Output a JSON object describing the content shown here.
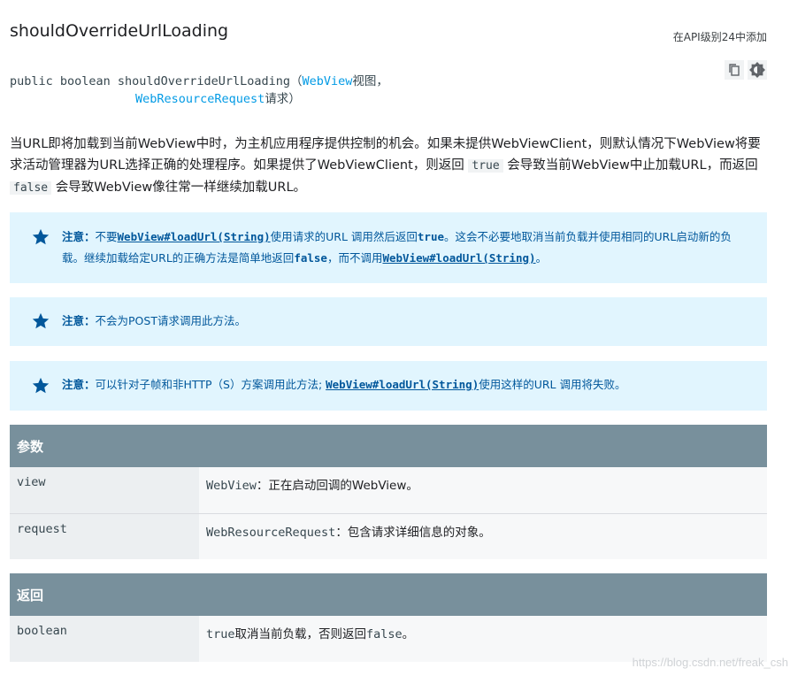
{
  "header": {
    "title": "shouldOverrideUrlLoading",
    "api_level": "在API级别24中添加"
  },
  "signature": {
    "prefix": "public boolean shouldOverrideUrlLoading",
    "open_paren": "（",
    "param1_type": "WebView",
    "param1_name": "视图",
    "comma": "，",
    "param2_type": "WebResourceRequest",
    "param2_name": "请求",
    "close_paren": "）",
    "copy_icon": "copy-icon",
    "theme_icon": "brightness-icon"
  },
  "description": {
    "part1": "当URL即将加载到当前WebView中时，为主机应用程序提供控制的机会。如果未提供WebViewClient，则默认情况下WebView将要求活动管理器为URL选择正确的处理程序。如果提供了WebViewClient，则返回 ",
    "code_true": "true",
    "part2": " 会导致当前WebView中止加载URL，而返回 ",
    "code_false": "false",
    "part3": " 会导致WebView像往常一样继续加载URL。"
  },
  "notes": [
    {
      "icon": "star-icon",
      "label": "注意：",
      "t1": "不要",
      "link1": "WebView#loadUrl(String)",
      "t2": "使用请求的URL 调用然后返回",
      "code1": "true",
      "t3": "。这会不必要地取消当前负载并使用相同的URL启动新的负载。继续加载给定URL的正确方法是简单地返回",
      "code2": "false",
      "t4": "，而不调用",
      "link2": "WebView#loadUrl(String)",
      "t5": "。"
    },
    {
      "icon": "star-icon",
      "label": "注意：",
      "t1": "不会为POST请求调用此方法。"
    },
    {
      "icon": "star-icon",
      "label": "注意：",
      "t1": "可以针对子帧和非HTTP（S）方案调用此方法; ",
      "link1": "WebView#loadUrl(String)",
      "t2": "使用这样的URL 调用将失败。"
    }
  ],
  "params_table": {
    "header": "参数",
    "rows": [
      {
        "name": "view",
        "type": "WebView",
        "desc": "：正在启动回调的WebView。"
      },
      {
        "name": "request",
        "type": "WebResourceRequest",
        "desc": "：包含请求详细信息的对象。"
      }
    ]
  },
  "returns_table": {
    "header": "返回",
    "rows": [
      {
        "name": "boolean",
        "code1": "true",
        "t1": "取消当前负载，否则返回",
        "code2": "false",
        "t2": "。"
      }
    ]
  },
  "watermark": "https://blog.csdn.net/freak_csh",
  "colors": {
    "note_bg": "#e1f5fe",
    "note_text": "#01579b",
    "table_header": "#78909c",
    "link": "#039be5"
  }
}
